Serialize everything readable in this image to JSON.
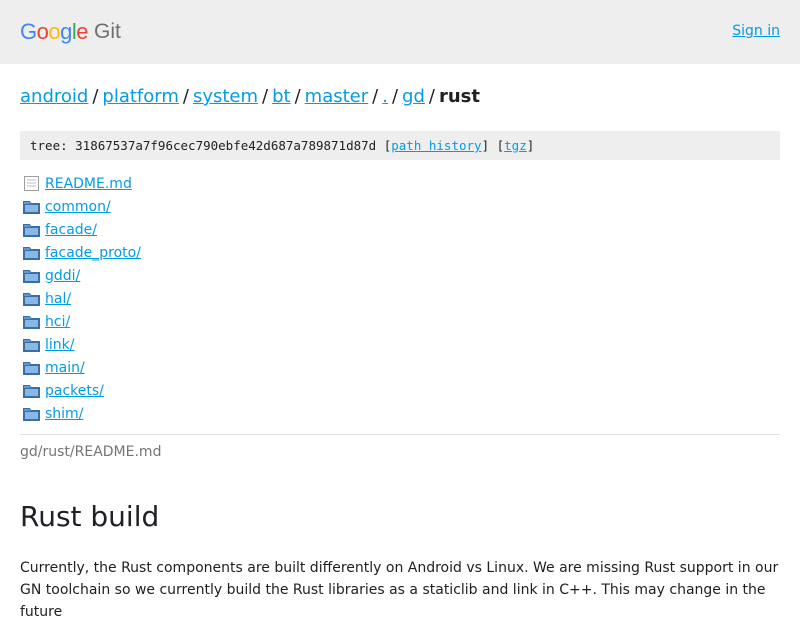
{
  "header": {
    "logo_google": "Google",
    "logo_git": "Git",
    "signin_label": "Sign in"
  },
  "breadcrumb": {
    "items": [
      "android",
      "platform",
      "system",
      "bt",
      "master",
      ".",
      "gd"
    ],
    "separator": "/",
    "current": "rust"
  },
  "tree": {
    "prefix": "tree: 31867537a7f96cec790ebfe42d687a789871d87d",
    "open_bracket": "[",
    "close_bracket": "]",
    "path_history_label": "path history",
    "tgz_label": "tgz"
  },
  "files": [
    {
      "name": "README.md",
      "type": "file"
    },
    {
      "name": "common/",
      "type": "folder"
    },
    {
      "name": "facade/",
      "type": "folder"
    },
    {
      "name": "facade_proto/",
      "type": "folder"
    },
    {
      "name": "gddi/",
      "type": "folder"
    },
    {
      "name": "hal/",
      "type": "folder"
    },
    {
      "name": "hci/",
      "type": "folder"
    },
    {
      "name": "link/",
      "type": "folder"
    },
    {
      "name": "main/",
      "type": "folder"
    },
    {
      "name": "packets/",
      "type": "folder"
    },
    {
      "name": "shim/",
      "type": "folder"
    }
  ],
  "readme": {
    "path": "gd/rust/README.md",
    "title": "Rust build",
    "paragraph": "Currently, the Rust components are built differently on Android vs Linux. We are missing Rust support in our GN toolchain so we currently build the Rust libraries as a staticlib and link in C++. This may change in the future"
  },
  "colors": {
    "link": "#039be5",
    "header_bg": "#eeeeee",
    "folder_icon": "#4a8fc9"
  },
  "icons": {
    "file": "file-icon",
    "folder": "folder-icon"
  }
}
